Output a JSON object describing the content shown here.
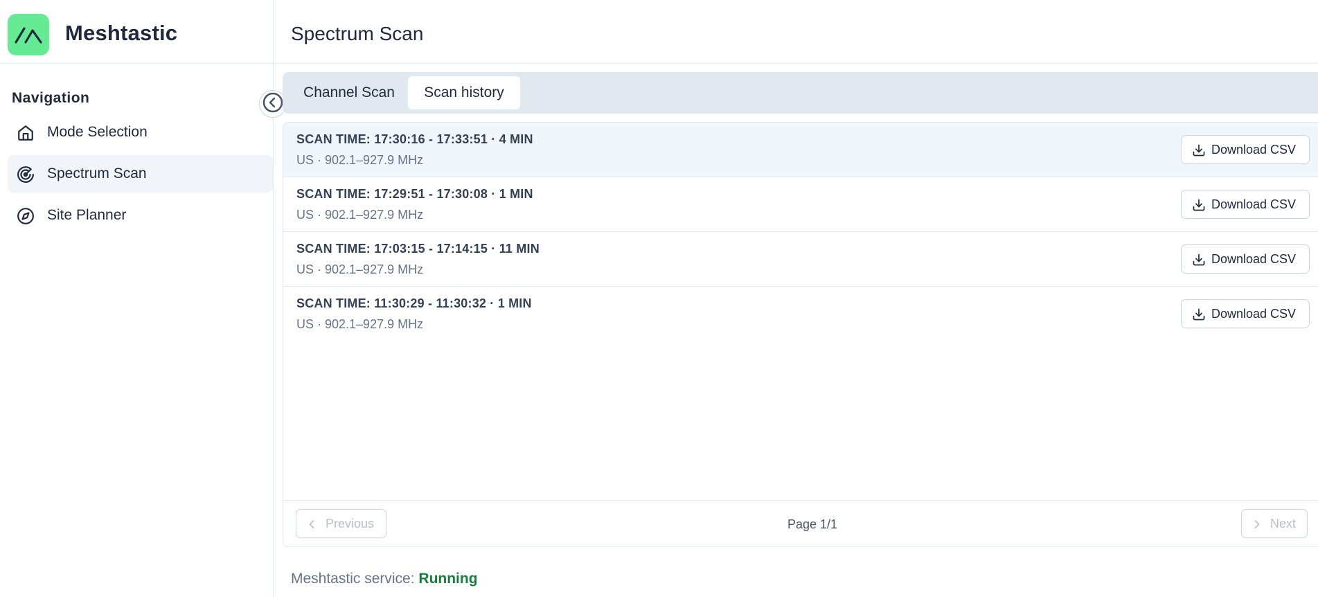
{
  "app": {
    "name": "Meshtastic"
  },
  "header": {
    "title": "Spectrum Scan"
  },
  "sidebar": {
    "heading": "Navigation",
    "items": [
      {
        "label": "Mode Selection",
        "icon": "home-icon",
        "active": false
      },
      {
        "label": "Spectrum Scan",
        "icon": "radar-icon",
        "active": true
      },
      {
        "label": "Site Planner",
        "icon": "compass-icon",
        "active": false
      }
    ]
  },
  "tabs": [
    {
      "label": "Channel Scan",
      "active": false
    },
    {
      "label": "Scan history",
      "active": true
    }
  ],
  "scans": [
    {
      "title": "SCAN TIME: 17:30:16 - 17:33:51 · 4 MIN",
      "subtitle": "US · 902.1–927.9 MHz",
      "download_label": "Download CSV"
    },
    {
      "title": "SCAN TIME: 17:29:51 - 17:30:08 · 1 MIN",
      "subtitle": "US · 902.1–927.9 MHz",
      "download_label": "Download CSV"
    },
    {
      "title": "SCAN TIME: 17:03:15 - 17:14:15 · 11 MIN",
      "subtitle": "US · 902.1–927.9 MHz",
      "download_label": "Download CSV"
    },
    {
      "title": "SCAN TIME: 11:30:29 - 11:30:32 · 1 MIN",
      "subtitle": "US · 902.1–927.9 MHz",
      "download_label": "Download CSV"
    }
  ],
  "pagination": {
    "previous_label": "Previous",
    "next_label": "Next",
    "page_info": "Page 1/1"
  },
  "status": {
    "label": "Meshtastic service:",
    "value": "Running"
  },
  "colors": {
    "accent": "#67ea94",
    "running": "#15803d",
    "highlight_row": "#f0f6fc",
    "tab_bar": "#e2e8f0"
  }
}
